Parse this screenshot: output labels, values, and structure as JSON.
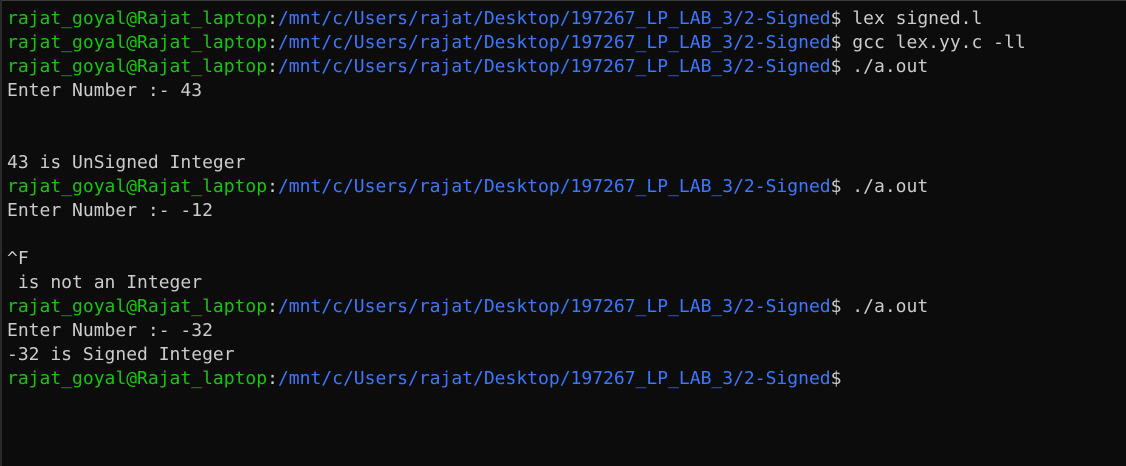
{
  "colors": {
    "background": "#0c0c0c",
    "user_host": "#16c60c",
    "path": "#3b78ff",
    "text": "#cccccc"
  },
  "prompt": {
    "user_host": "rajat_goyal@Rajat_laptop",
    "colon": ":",
    "path": "/mnt/c/Users/rajat/Desktop/197267_LP_LAB_3/2-Signed",
    "symbol": "$"
  },
  "lines": [
    {
      "type": "prompt",
      "command": " lex signed.l"
    },
    {
      "type": "prompt",
      "command": " gcc lex.yy.c -ll"
    },
    {
      "type": "prompt",
      "command": " ./a.out"
    },
    {
      "type": "output",
      "text": "Enter Number :- 43"
    },
    {
      "type": "output",
      "text": ""
    },
    {
      "type": "output",
      "text": ""
    },
    {
      "type": "output",
      "text": "43 is UnSigned Integer"
    },
    {
      "type": "prompt",
      "command": " ./a.out"
    },
    {
      "type": "output",
      "text": "Enter Number :- -12"
    },
    {
      "type": "output",
      "text": ""
    },
    {
      "type": "output",
      "text": "^F"
    },
    {
      "type": "output",
      "text": " is not an Integer"
    },
    {
      "type": "prompt",
      "command": " ./a.out"
    },
    {
      "type": "output",
      "text": "Enter Number :- -32"
    },
    {
      "type": "output",
      "text": "-32 is Signed Integer"
    },
    {
      "type": "prompt",
      "command": ""
    }
  ]
}
